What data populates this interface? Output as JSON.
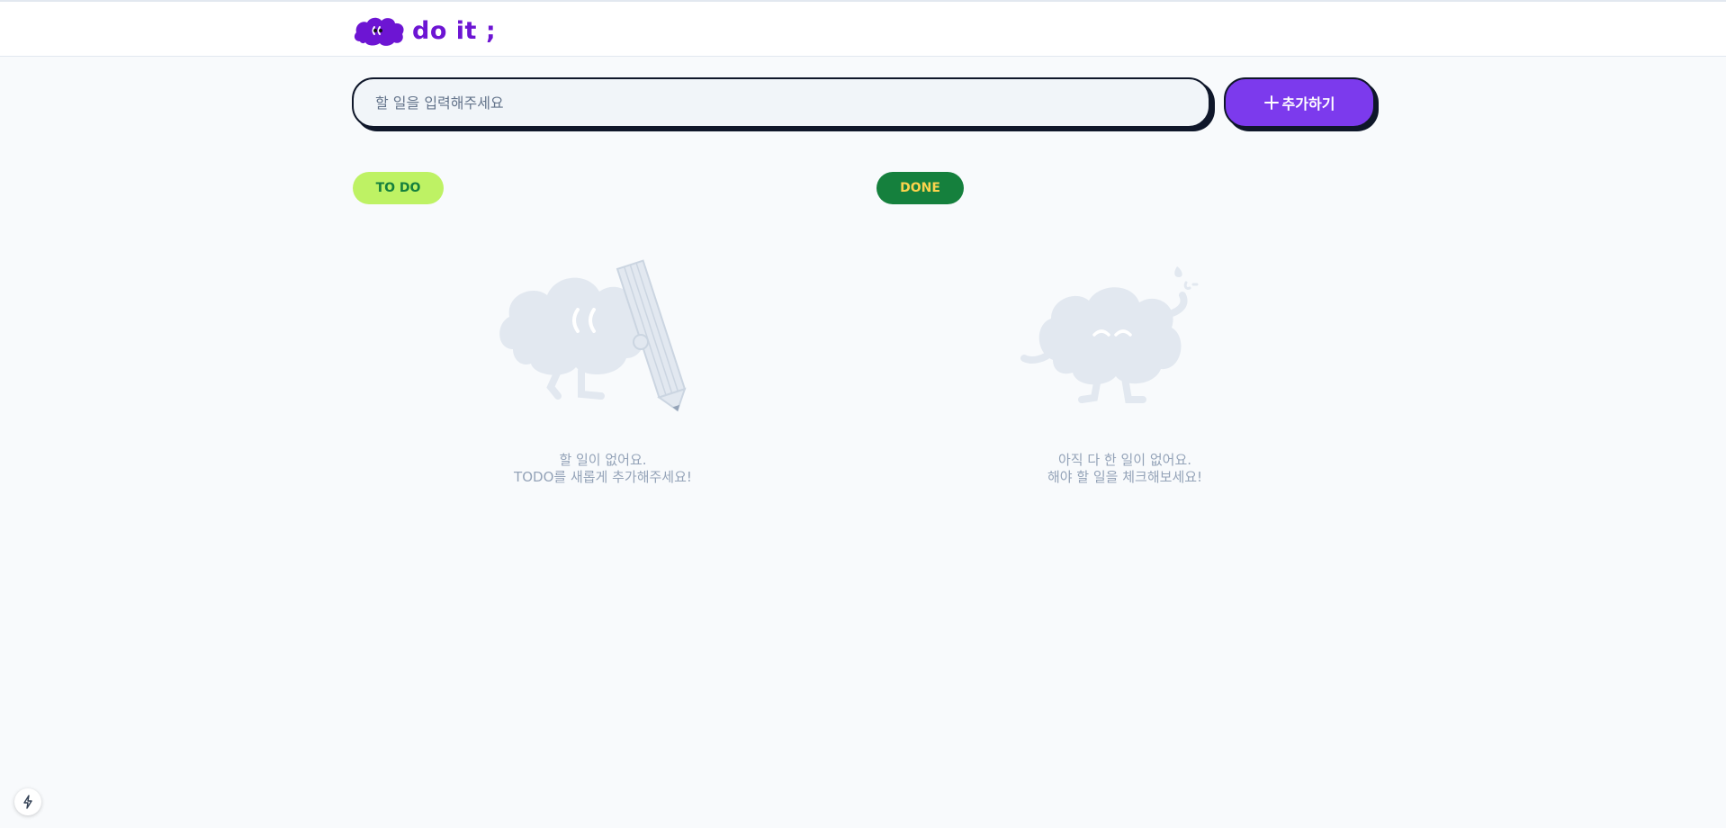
{
  "header": {
    "logo_text": "do it ;",
    "brand_color": "#6d15d3"
  },
  "todo_input": {
    "placeholder": "할 일을 입력해주세요",
    "value": ""
  },
  "add_button": {
    "icon": "plus-icon",
    "label": "추가하기",
    "color": "#7c3aed"
  },
  "sections": {
    "todo": {
      "badge": "TO DO",
      "badge_color": "#bef264",
      "empty_illustration": "cloud-with-pencil",
      "empty_line1": "할 일이 없어요.",
      "empty_line2": "TODO를 새롭게 추가해주세요!"
    },
    "done": {
      "badge": "DONE",
      "badge_color": "#15803d",
      "empty_illustration": "cloud-sweating",
      "empty_line1": "아직 다 한 일이 없어요.",
      "empty_line2": "해야 할 일을 체크해보세요!"
    }
  },
  "dev_indicator": {
    "icon": "lightning-icon"
  }
}
